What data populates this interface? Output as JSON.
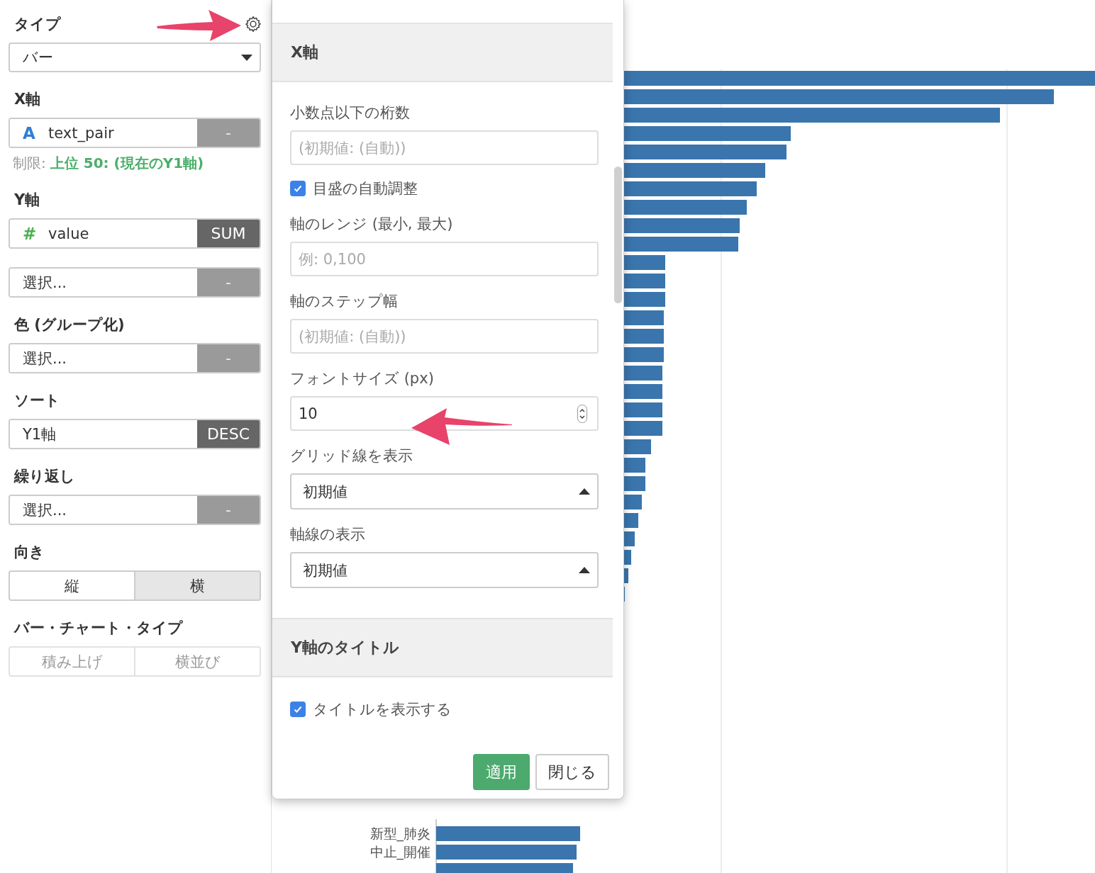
{
  "sidebar": {
    "sections": [
      {
        "label": "タイプ",
        "has_settings": true,
        "rows": [
          {
            "kind": "select",
            "value": "バー"
          }
        ]
      },
      {
        "label": "X軸",
        "has_settings": false,
        "rows": [
          {
            "kind": "field",
            "color": "#2f7fd4",
            "type_mark": "A",
            "value": "text_pair",
            "action": "-",
            "action_set": false
          },
          {
            "kind": "note",
            "prefix": "制限:",
            "text": "上位 50: (現在のY1軸)"
          }
        ]
      },
      {
        "label": "Y軸",
        "has_settings": false,
        "rows": [
          {
            "kind": "field",
            "color": "#4caf50",
            "type_mark": "#",
            "value": "value",
            "action": "SUM",
            "action_set": true
          },
          {
            "kind": "field",
            "value": "選択...",
            "action": "-",
            "action_set": false
          }
        ]
      },
      {
        "label": "色 (グループ化)",
        "has_settings": false,
        "rows": [
          {
            "kind": "field",
            "value": "選択...",
            "action": "-",
            "action_set": false
          }
        ]
      },
      {
        "label": "ソート",
        "has_settings": false,
        "rows": [
          {
            "kind": "field",
            "value": "Y1軸",
            "action": "DESC",
            "action_set": true
          }
        ]
      },
      {
        "label": "繰り返し",
        "has_settings": false,
        "rows": [
          {
            "kind": "field",
            "value": "選択...",
            "action": "-",
            "action_set": false
          }
        ]
      },
      {
        "label": "向き",
        "has_settings": false,
        "rows": [
          {
            "kind": "segmented",
            "options": [
              {
                "label": "縦",
                "selected": false,
                "disabled": false
              },
              {
                "label": "横",
                "selected": true,
                "disabled": false
              }
            ]
          }
        ]
      },
      {
        "label": "バー・チャート・タイプ",
        "has_settings": false,
        "rows": [
          {
            "kind": "segmented",
            "options": [
              {
                "label": "積み上げ",
                "selected": false,
                "disabled": true
              },
              {
                "label": "横並び",
                "selected": false,
                "disabled": true
              }
            ]
          }
        ]
      }
    ]
  },
  "popup": {
    "sections": [
      {
        "title": "X軸",
        "items": [
          {
            "kind": "input",
            "label": "小数点以下の桁数",
            "placeholder": "(初期値: (自動))"
          },
          {
            "kind": "checkbox",
            "label": "目盛の自動調整",
            "checked": true
          },
          {
            "kind": "input",
            "label": "軸のレンジ (最小, 最大)",
            "placeholder": "例: 0,100"
          },
          {
            "kind": "input",
            "label": "軸のステップ幅",
            "placeholder": "(初期値: (自動))"
          },
          {
            "kind": "number",
            "label": "フォントサイズ (px)",
            "value": "10"
          },
          {
            "kind": "select",
            "label": "グリッド線を表示",
            "value": "初期値"
          },
          {
            "kind": "select",
            "label": "軸線の表示",
            "value": "初期値"
          }
        ]
      },
      {
        "title": "Y軸のタイトル",
        "items": [
          {
            "kind": "checkbox",
            "label": "タイトルを表示する",
            "checked": true
          }
        ]
      }
    ],
    "buttons": [
      {
        "label": "適用",
        "primary": true
      },
      {
        "label": "閉じる",
        "primary": false
      }
    ]
  },
  "chart": {
    "labels": [
      "新型_肺炎",
      "中止_開催"
    ]
  }
}
